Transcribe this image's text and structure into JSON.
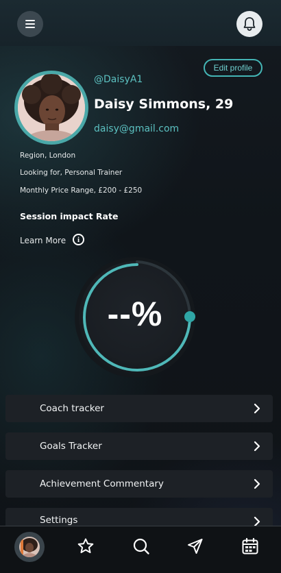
{
  "header": {
    "menu_icon": "hamburger-menu-icon",
    "notification_icon": "bell-icon"
  },
  "profile": {
    "edit_label": "Edit profile",
    "handle": "@DaisyA1",
    "name": "Daisy Simmons, 29",
    "email": "daisy@gmail.com",
    "region": "Region,  London",
    "looking_for": "Looking for,  Personal Trainer",
    "price_range": "Monthly Price Range, £200 - £250"
  },
  "impact": {
    "title": "Session impact Rate",
    "learn_more": "Learn More",
    "info_glyph": "i",
    "value": "--%"
  },
  "menu": [
    {
      "label": "Coach tracker"
    },
    {
      "label": "Goals Tracker"
    },
    {
      "label": "Achievement Commentary"
    },
    {
      "label": "Settings"
    }
  ],
  "bottom_nav": {
    "items": [
      "profile-avatar",
      "star-icon",
      "search-icon",
      "send-icon",
      "calendar-icon"
    ]
  },
  "colors": {
    "accent": "#44b5b5",
    "accent_text": "#5cc1c1",
    "row_bg": "#1d2126",
    "bell_bg": "#e8ecee"
  }
}
